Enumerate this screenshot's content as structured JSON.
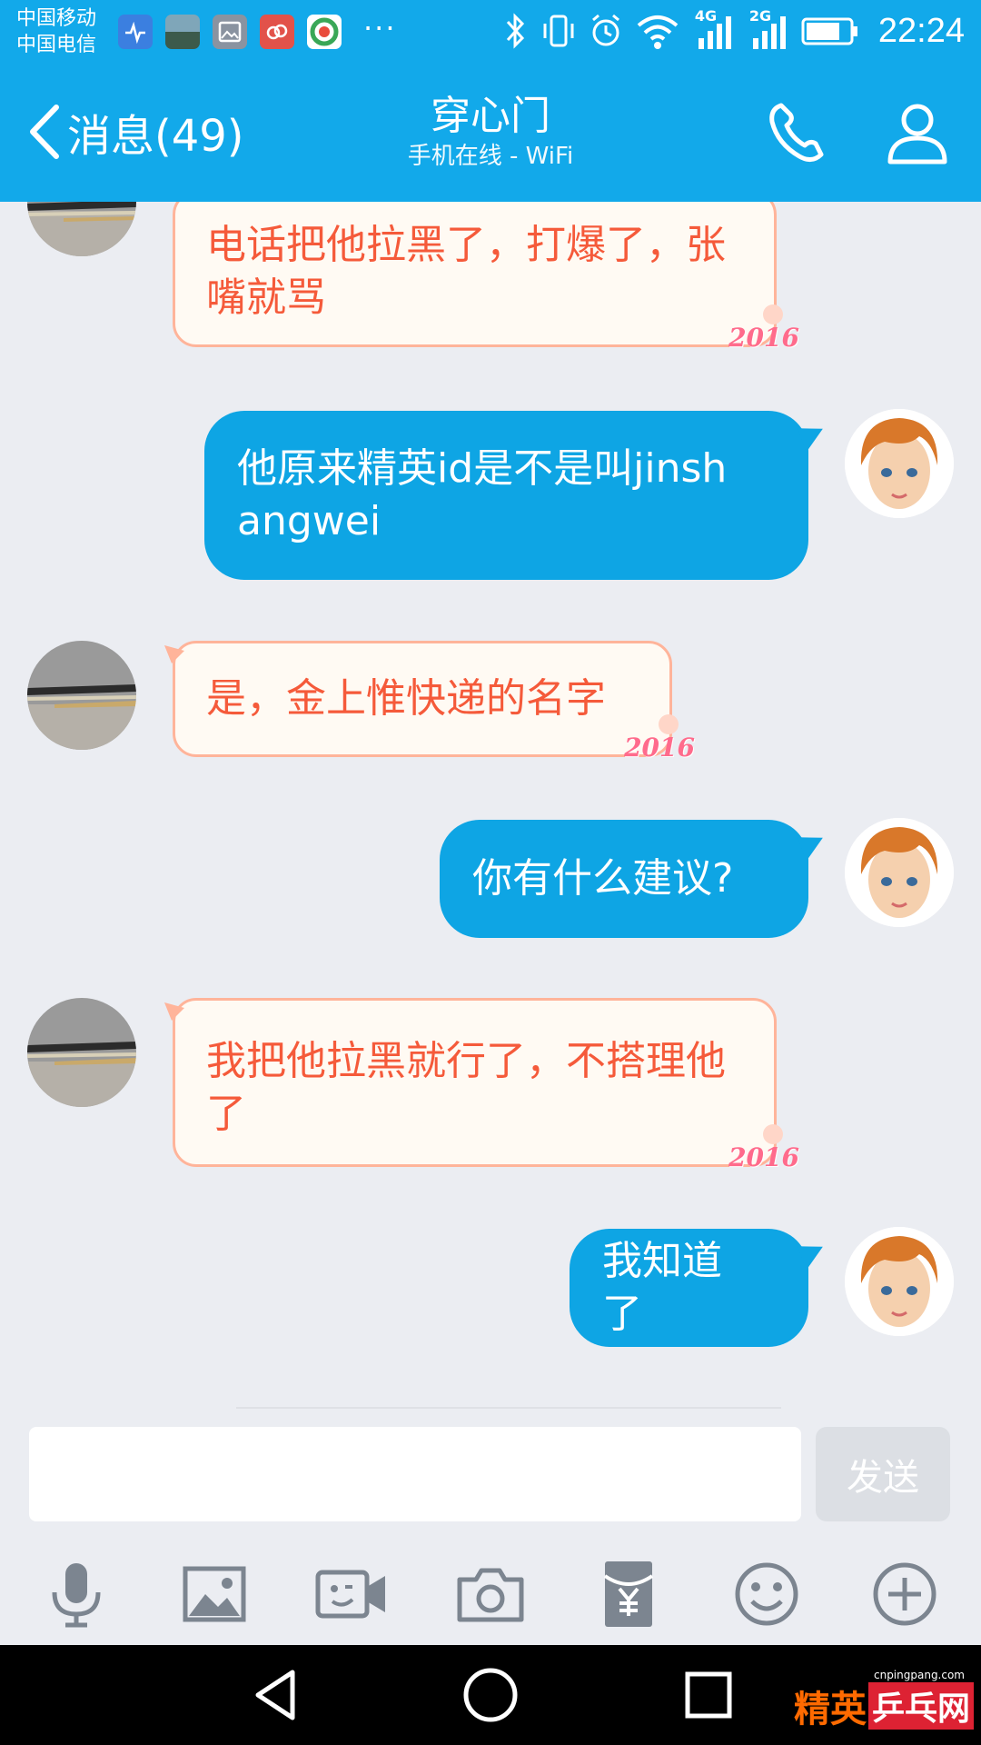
{
  "status_bar": {
    "carrier_1": "中国移动",
    "carrier_2": "中国电信",
    "more": "···",
    "net_1": "4G",
    "net_2": "2G",
    "time": "22:24",
    "icons": [
      "health-app-icon",
      "landscape-app-icon",
      "gallery-app-icon",
      "cloud-app-icon",
      "browser-app-icon",
      "bluetooth-icon",
      "vibrate-icon",
      "alarm-icon",
      "wifi-icon",
      "signal-icon",
      "signal-icon",
      "battery-icon"
    ]
  },
  "header": {
    "back_label": "消息(49)",
    "title": "穿心门",
    "subtitle": "手机在线 - WiFi",
    "color": "#12a9ea"
  },
  "messages": [
    {
      "side": "incoming",
      "text": "电话把他拉黑了，打爆了，张嘴就骂",
      "decoration": "2016"
    },
    {
      "side": "outgoing",
      "text": "他原来精英id是不是叫jinshangwei"
    },
    {
      "side": "incoming",
      "text": "是，金上惟快递的名字",
      "decoration": "2016"
    },
    {
      "side": "outgoing",
      "text": "你有什么建议?"
    },
    {
      "side": "incoming",
      "text": "我把他拉黑就行了，不搭理他了",
      "decoration": "2016"
    },
    {
      "side": "outgoing",
      "text": "我知道了"
    }
  ],
  "input": {
    "value": "",
    "send_label": "发送"
  },
  "toolbar": [
    "microphone-icon",
    "image-icon",
    "video-call-icon",
    "camera-icon",
    "red-packet-icon",
    "emoji-icon",
    "plus-icon"
  ],
  "watermark": {
    "site": "cnpingpang.com",
    "brand_a": "精英",
    "brand_b": "乒乓网"
  },
  "colors": {
    "incoming_text": "#f55a3a",
    "incoming_border": "#ffb49a",
    "outgoing_bg": "#0ea5e4",
    "background": "#ebedf2"
  }
}
